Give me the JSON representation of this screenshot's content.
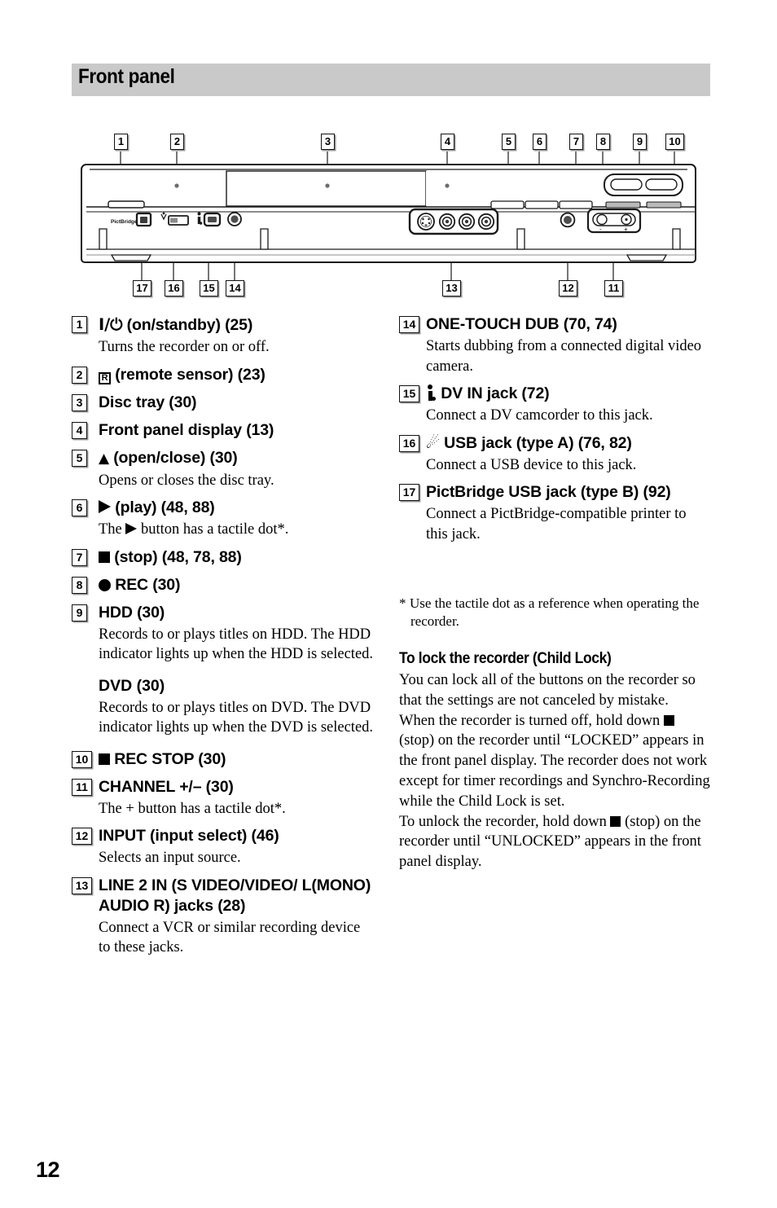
{
  "page": {
    "section_title": "Front panel",
    "page_number": "12"
  },
  "diagram": {
    "device_label": "PictBridge",
    "minus_label": "-",
    "plus_label": "+",
    "top_callouts": [
      "1",
      "2",
      "3",
      "4",
      "5",
      "6",
      "7",
      "8",
      "9",
      "10"
    ],
    "bottom_callouts": [
      "17",
      "16",
      "15",
      "14",
      "13",
      "12",
      "11"
    ]
  },
  "left_column": [
    {
      "num": "1",
      "icon": "power-on-standby-icon",
      "title_prefix": "I/⏻",
      "title": " (on/standby) (25)",
      "desc": "Turns the recorder on or off."
    },
    {
      "num": "2",
      "icon": "remote-sensor-icon",
      "title_prefix": "R",
      "title": " (remote sensor) (23)",
      "desc": ""
    },
    {
      "num": "3",
      "icon": "",
      "title_prefix": "",
      "title": "Disc tray (30)",
      "desc": ""
    },
    {
      "num": "4",
      "icon": "",
      "title_prefix": "",
      "title": "Front panel display (13)",
      "desc": ""
    },
    {
      "num": "5",
      "icon": "eject-icon",
      "title_prefix": "▲",
      "title": " (open/close) (30)",
      "desc": "Opens or closes the disc tray."
    },
    {
      "num": "6",
      "icon": "play-icon",
      "title_prefix": "",
      "title": " (play) (48, 88)",
      "desc_pre": "The ",
      "desc_post": " button has a tactile dot*."
    },
    {
      "num": "7",
      "icon": "stop-icon",
      "title_prefix": "",
      "title": " (stop) (48, 78, 88)",
      "desc": ""
    },
    {
      "num": "8",
      "icon": "record-icon",
      "title_prefix": "",
      "title": " REC (30)",
      "desc": ""
    },
    {
      "num": "9",
      "icon": "",
      "title_prefix": "",
      "title": "HDD (30)",
      "desc": "Records to or plays titles on HDD. The HDD indicator lights up when the HDD is selected.",
      "sub_title": "DVD (30)",
      "sub_desc": "Records to or plays titles on DVD. The DVD indicator lights up when the DVD is selected."
    },
    {
      "num": "10",
      "icon": "stop-icon",
      "title_prefix": "",
      "title": " REC STOP (30)",
      "desc": ""
    },
    {
      "num": "11",
      "icon": "",
      "title_prefix": "",
      "title": "CHANNEL +/– (30)",
      "desc": "The + button has a tactile dot*."
    },
    {
      "num": "12",
      "icon": "",
      "title_prefix": "",
      "title": "INPUT (input select) (46)",
      "desc": "Selects an input source."
    },
    {
      "num": "13",
      "icon": "",
      "title_prefix": "",
      "title": "LINE 2 IN (S VIDEO/VIDEO/ L(MONO) AUDIO R) jacks (28)",
      "desc": "Connect a VCR or similar recording device to these jacks."
    }
  ],
  "right_column": [
    {
      "num": "14",
      "icon": "",
      "title": "ONE-TOUCH DUB (70, 74)",
      "desc": "Starts dubbing from a connected digital video camera."
    },
    {
      "num": "15",
      "icon": "ilink-dv-icon",
      "title": " DV IN jack (72)",
      "desc": "Connect a DV camcorder to this jack."
    },
    {
      "num": "16",
      "icon": "usb-icon",
      "title": " USB jack (type A) (76, 82)",
      "desc": "Connect a USB device to this jack."
    },
    {
      "num": "17",
      "icon": "",
      "title": "PictBridge USB jack (type B) (92)",
      "desc": "Connect a PictBridge-compatible printer to this jack."
    }
  ],
  "footnote": {
    "marker": "*",
    "text": "Use the tactile dot as a reference when operating the recorder."
  },
  "child_lock": {
    "heading": "To lock the recorder (Child Lock)",
    "para1": "You can lock all of the buttons on the recorder so that the settings are not canceled by mistake.",
    "para2_pre": "When the recorder is turned off, hold down ",
    "para2_post": " (stop) on the recorder until “LOCKED” appears in the front panel display. The recorder does not work except for timer recordings and Synchro-Recording while the Child Lock is set.",
    "para3_pre": "To unlock the recorder, hold down ",
    "para3_post": " (stop) on the recorder until “UNLOCKED” appears in the front panel display."
  },
  "colors": {
    "header_band": "#c9c9c9",
    "text": "#000000",
    "device_outline": "#1a1a1a"
  }
}
